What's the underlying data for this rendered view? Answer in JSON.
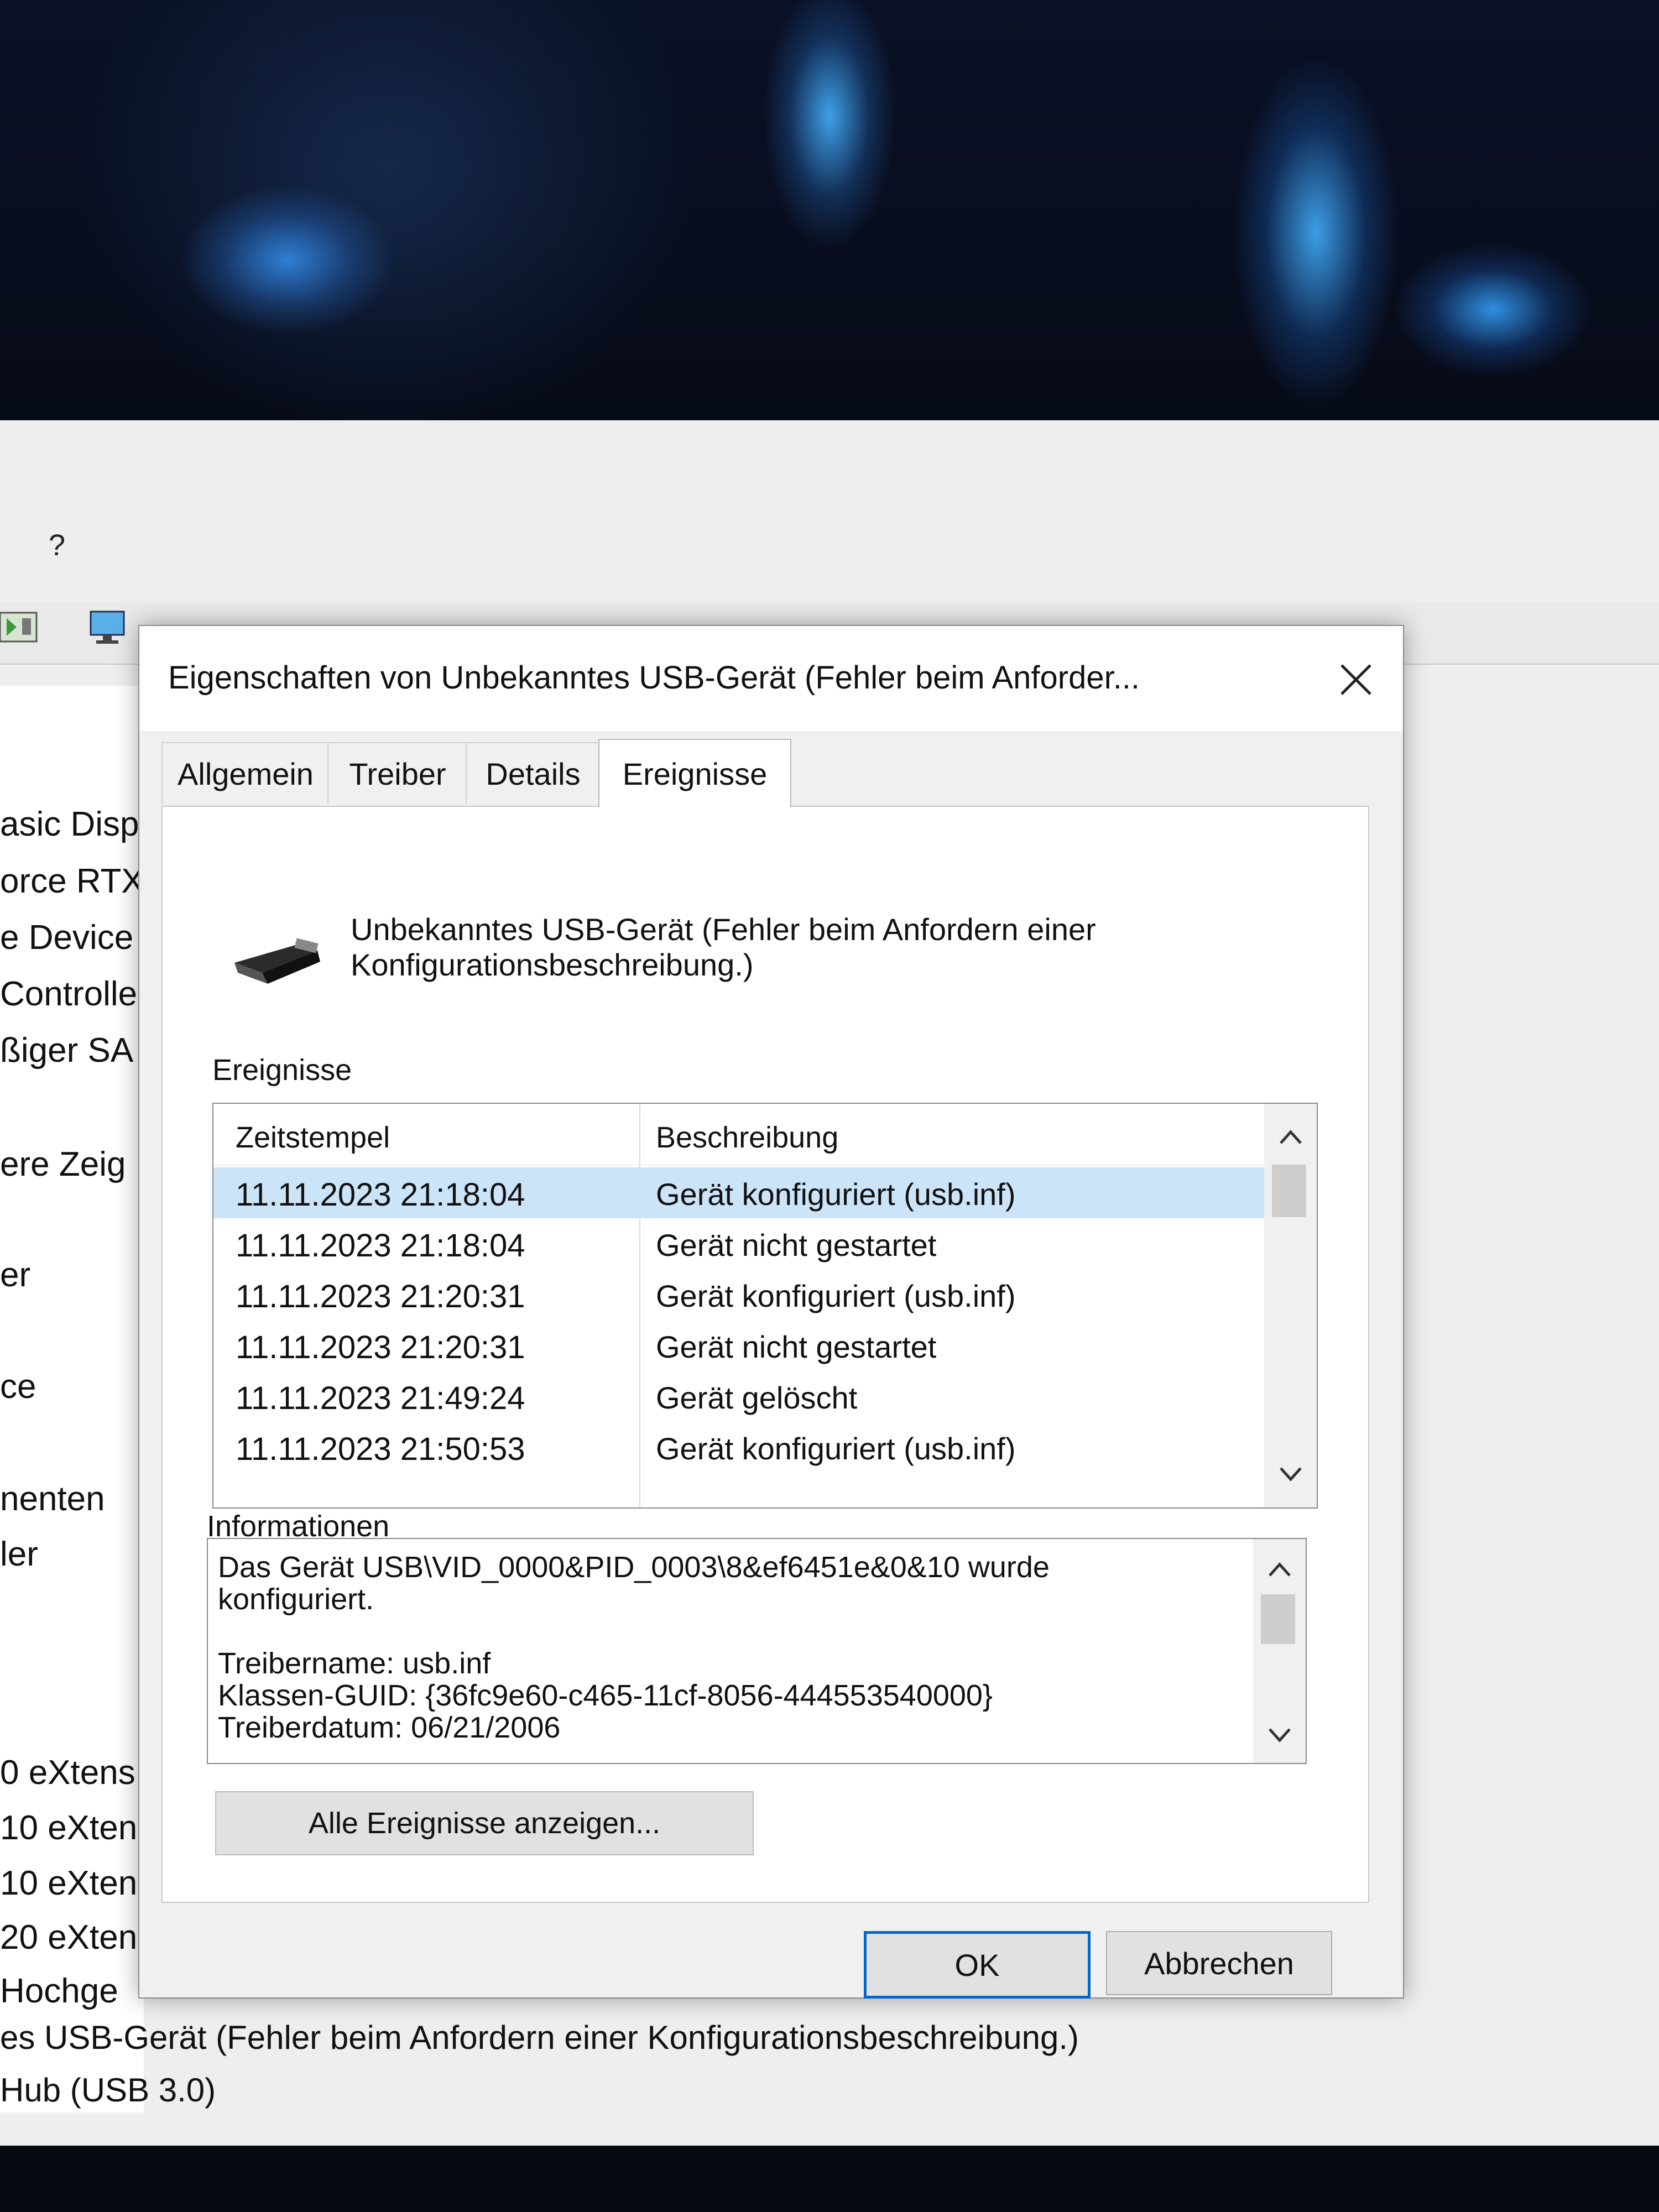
{
  "background_window": {
    "menu_help": "?",
    "tree_items": [
      "asic Disp",
      "orce RTX",
      "e Device",
      "Controlle",
      "ßiger SA",
      "ere Zeig",
      "er",
      "ce",
      "nenten",
      "ler",
      "0 eXtens",
      "10 eXten",
      "10 eXten",
      "20 eXten",
      "Hochge"
    ],
    "status_line1": "es USB-Gerät (Fehler beim Anfordern einer Konfigurationsbeschreibung.)",
    "status_line2": "Hub (USB 3.0)"
  },
  "dialog": {
    "title": "Eigenschaften von Unbekanntes USB-Gerät (Fehler beim Anforder...",
    "tabs": [
      {
        "label": "Allgemein"
      },
      {
        "label": "Treiber"
      },
      {
        "label": "Details"
      },
      {
        "label": "Ereignisse"
      }
    ],
    "active_tab": "Ereignisse",
    "device_name_line1": "Unbekanntes USB-Gerät (Fehler beim Anfordern einer",
    "device_name_line2": "Konfigurationsbeschreibung.)",
    "events_label": "Ereignisse",
    "events_table": {
      "columns": [
        "Zeitstempel",
        "Beschreibung"
      ],
      "rows": [
        {
          "time": "11.11.2023 21:18:04",
          "description": "Gerät konfiguriert (usb.inf)"
        },
        {
          "time": "11.11.2023 21:18:04",
          "description": "Gerät nicht gestartet"
        },
        {
          "time": "11.11.2023 21:20:31",
          "description": "Gerät konfiguriert (usb.inf)"
        },
        {
          "time": "11.11.2023 21:20:31",
          "description": "Gerät nicht gestartet"
        },
        {
          "time": "11.11.2023 21:49:24",
          "description": "Gerät gelöscht"
        },
        {
          "time": "11.11.2023 21:50:53",
          "description": "Gerät konfiguriert (usb.inf)"
        }
      ]
    },
    "info_label": "Informationen",
    "info_lines": [
      "Das Gerät USB\\VID_0000&PID_0003\\8&ef6451e&0&10 wurde",
      "konfiguriert.",
      "",
      "Treibername: usb.inf",
      "Klassen-GUID: {36fc9e60-c465-11cf-8056-444553540000}",
      "Treiberdatum: 06/21/2006"
    ],
    "all_events_button": "Alle Ereignisse anzeigen...",
    "ok_button": "OK",
    "cancel_button": "Abbrechen"
  },
  "colors": {
    "selection": "#cce4f7",
    "focus_border": "#0066cc",
    "dialog_bg": "#f0f0f0"
  },
  "icons": [
    "usb-device-icon",
    "close-icon",
    "chevron-up-icon",
    "chevron-down-icon"
  ]
}
